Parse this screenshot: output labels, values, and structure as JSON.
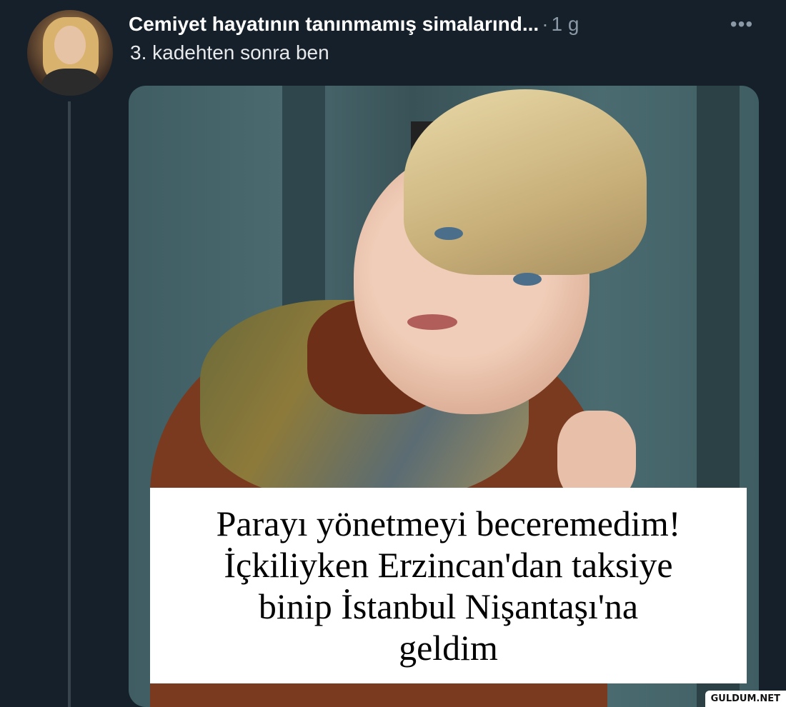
{
  "tweet": {
    "author_name": "Cemiyet hayatının tanınmamış simalarınd...",
    "separator": "·",
    "timestamp": "1 g",
    "more_label": "•••",
    "text": "3. kadehten sonra ben",
    "avatar_icon": "profile-photo",
    "media": {
      "caption_lines": [
        "Parayı yönetmeyi beceremedim!",
        "İçkiliyken Erzincan'dan taksiye",
        "binip İstanbul Nişantaşı'na",
        "geldim"
      ]
    }
  },
  "watermark": "GULDUM.NET",
  "colors": {
    "background": "#15202b",
    "secondary_text": "#8b98a5",
    "thread_line": "#38444d"
  }
}
